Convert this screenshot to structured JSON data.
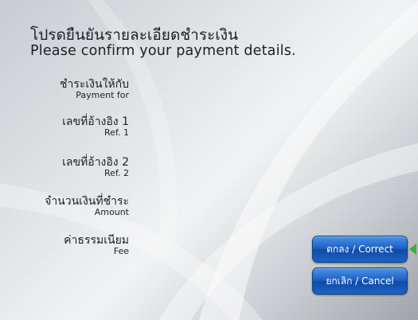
{
  "header": {
    "title_th": "โปรดยืนยันรายละเอียดชำระเงิน",
    "title_en": "Please confirm your payment details."
  },
  "fields": [
    {
      "label_th": "ชำระเงินให้กับ",
      "label_en": "Payment for"
    },
    {
      "label_th": "เลขที่อ้างอิง 1",
      "label_en": "Ref. 1"
    },
    {
      "label_th": "เลขที่อ้างอิง 2",
      "label_en": "Ref. 2"
    },
    {
      "label_th": "จำนวนเงินที่ชำระ",
      "label_en": "Amount"
    },
    {
      "label_th": "ค่าธรรมเนียม",
      "label_en": "Fee"
    }
  ],
  "buttons": {
    "correct_label": "ตกลง / Correct",
    "cancel_label": "ยกเลิก / Cancel"
  },
  "colors": {
    "button_blue": "#1b5fc0",
    "indicator_green": "#3fae3a",
    "background_silver": "#e4e6e9"
  },
  "icons": {
    "correct_indicator": "arrow-left-icon"
  }
}
